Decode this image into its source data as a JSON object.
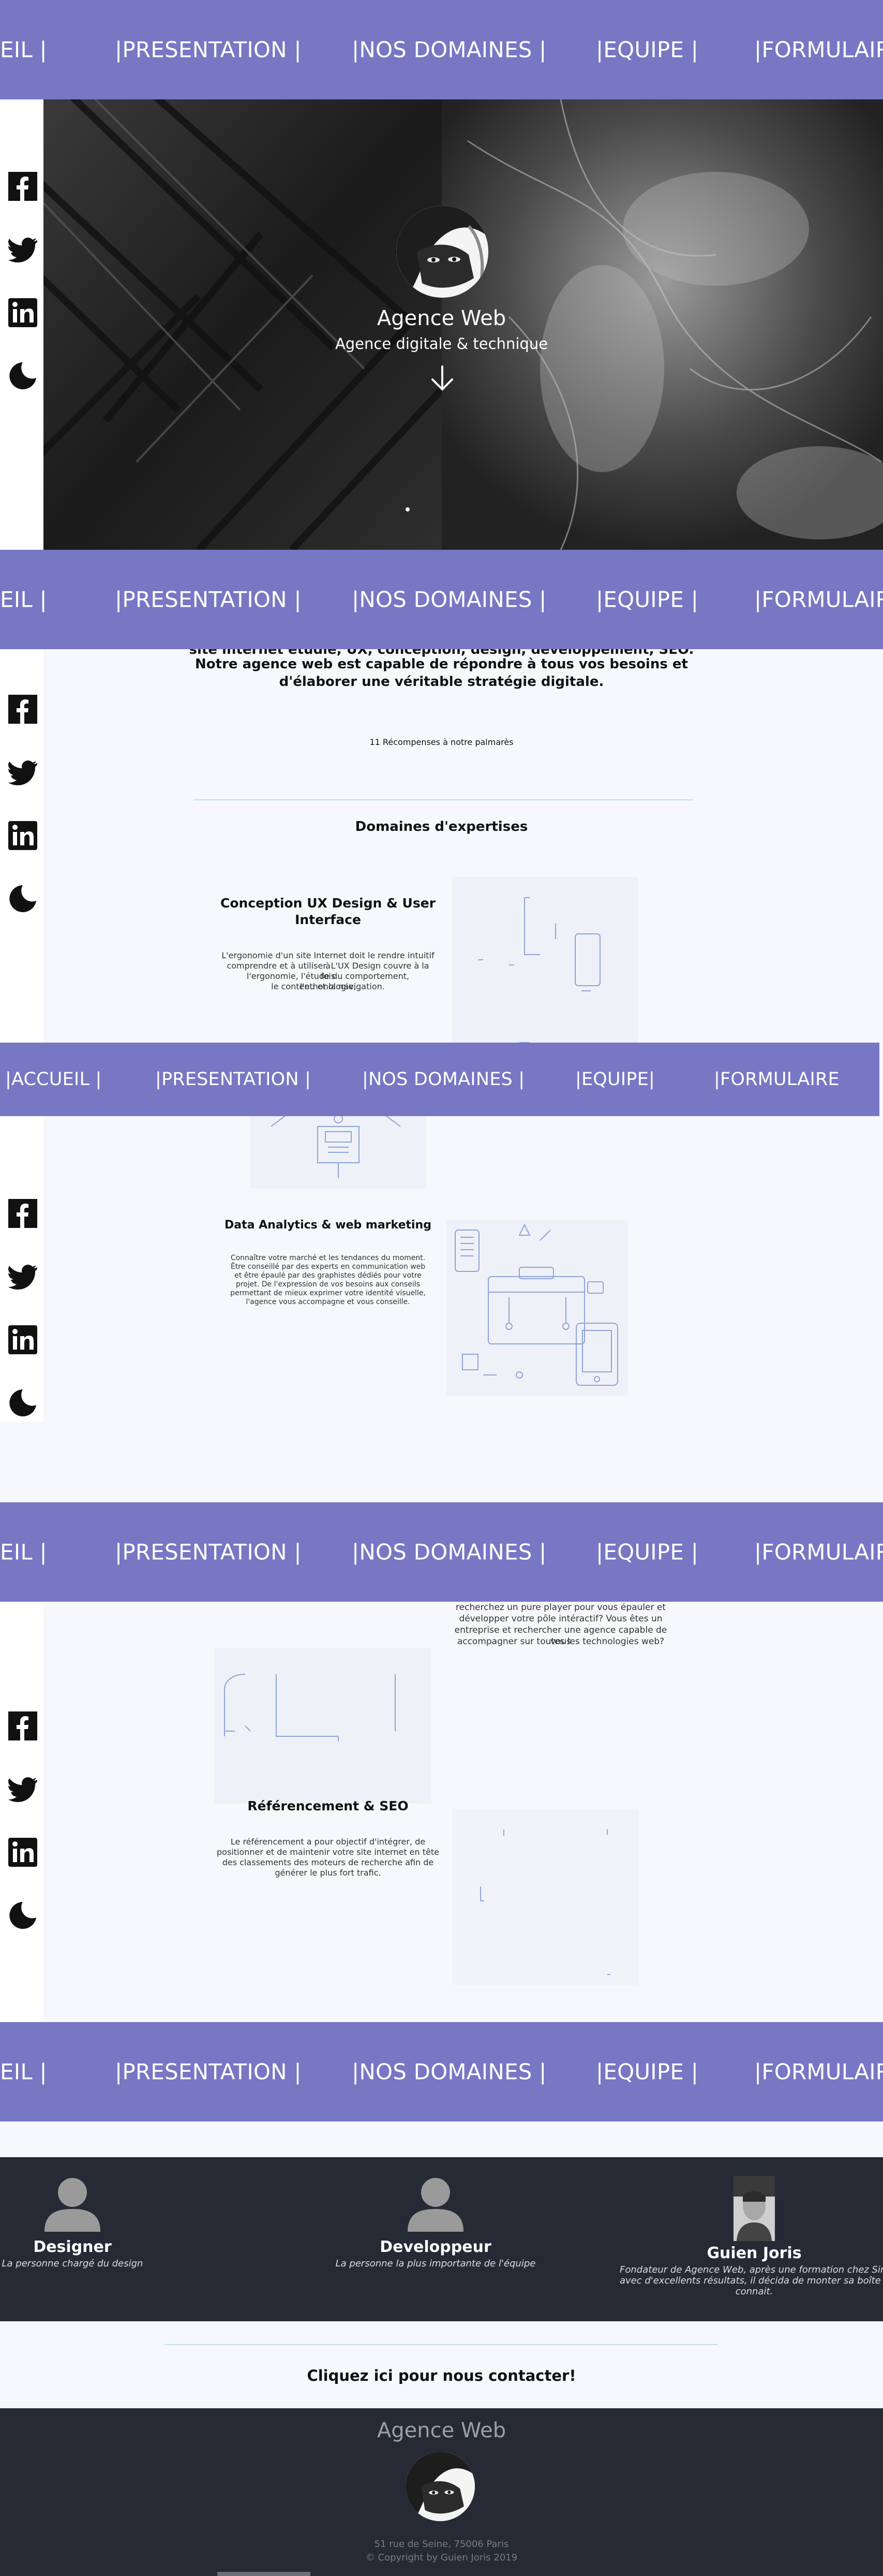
{
  "nav": {
    "accueil_cut": "EIL |",
    "accueil": "|ACCUEIL |",
    "presentation": "|PRESENTATION |",
    "domaines": "|NOS DOMAINES |",
    "equipe": "|EQUIPE |",
    "equipe_alt": "|EQUIPE|",
    "formulaire": "|FORMULAIRE"
  },
  "social": {
    "facebook": "facebook-icon",
    "twitter": "twitter-icon",
    "linkedin": "linkedin-icon",
    "theme": "moon-icon"
  },
  "hero": {
    "title": "Agence Web",
    "subtitle": "Agence digitale & technique"
  },
  "presentation": {
    "cut_line": "site internet étudie, UX, conception, design, développement, SEO.",
    "line1": "Notre agence web est capable de répondre à tous vos besoins et",
    "line2": "d'élaborer une véritable stratégie digitale.",
    "awards": "11 Récompenses à notre palmarès"
  },
  "domaines": {
    "title": "Domaines d'expertises",
    "ux": {
      "title_line1": "Conception UX Design & User",
      "title_line2": "Interface",
      "desc": [
        "L'ergonomie d'un site Internet doit le rendre intuitif à",
        "comprendre et à utiliser. L'UX Design couvre à la fois",
        "l'ergonomie, l'étude du comportement, l'ethonologie,",
        "le contenu et la navigation."
      ]
    },
    "data": {
      "title": "Data Analytics & web marketing",
      "desc": [
        "Connaître votre marché et les tendances du moment.",
        "Être conseillé par des experts en communication web",
        "et être épaulé par des graphistes dédiés pour votre",
        "projet. De l'expression de vos besoins aux conseils",
        "permettant de mieux exprimer votre identité visuelle,",
        "l'agence vous accompagne et vous conseille."
      ]
    },
    "dev": {
      "desc": [
        "recherchez un pure player pour vous épauler et",
        "développer votre pôle intéractif? Vous êtes un",
        "entreprise et rechercher une agence capable de vous",
        "accompagner sur toutes les technologies web?"
      ]
    },
    "seo": {
      "title": "Référencement & SEO",
      "desc": [
        "Le référencement a pour objectif d'intégrer, de",
        "positionner et de maintenir votre site internet en tête",
        "des classements des moteurs de recherche afin de",
        "générer le plus fort trafic."
      ]
    }
  },
  "team": {
    "members": [
      {
        "name": "Designer",
        "role": "La personne chargé du design"
      },
      {
        "name": "Developpeur",
        "role": "La personne la plus importante de l'équipe"
      },
      {
        "name": "Guien Joris",
        "role_lines": [
          "Fondateur de Agence Web, après une formation chez Simpl",
          "avec d'excellents résultats, il décida de monter sa boîte av",
          "connait."
        ]
      }
    ]
  },
  "contact": {
    "link": "Cliquez ici pour nous contacter!"
  },
  "footer": {
    "title": "Agence Web",
    "address": "51 rue de Seine, 75006 Paris",
    "copyright": "© Copyright by Guien Joris 2019"
  },
  "colors": {
    "nav_bg": "#7777c4",
    "dark_bg": "#252a35",
    "page_bg": "#f6f8fb",
    "divider": "#bfe3e3",
    "line_art": "#8fa3d6"
  }
}
